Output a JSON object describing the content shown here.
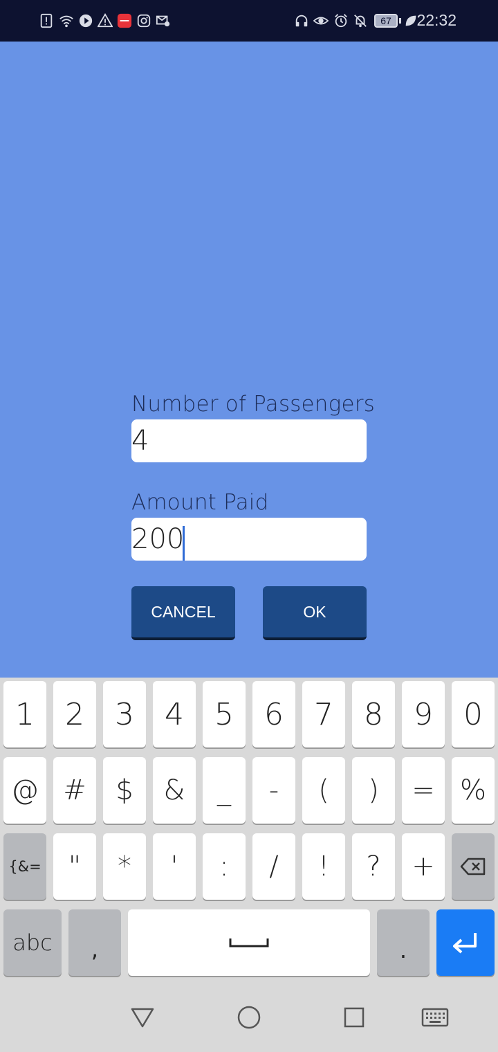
{
  "status_bar": {
    "battery_level": "67",
    "time": "22:32",
    "left_icons": [
      "alert-icon",
      "wifi-icon",
      "play-icon",
      "warning-icon",
      "huawei-app-icon",
      "instagram-icon",
      "mail-settings-icon"
    ],
    "right_icons": [
      "headset-icon",
      "eye-icon",
      "alarm-icon",
      "bell-off-icon",
      "battery-icon",
      "leaf-icon"
    ]
  },
  "form": {
    "passengers_label": "Number of Passengers",
    "passengers_value": "4",
    "amount_label": "Amount Paid",
    "amount_value": "200",
    "cancel_label": "CANCEL",
    "ok_label": "OK"
  },
  "keyboard": {
    "row1": [
      "1",
      "2",
      "3",
      "4",
      "5",
      "6",
      "7",
      "8",
      "9",
      "0"
    ],
    "row2": [
      "@",
      "#",
      "$",
      "&",
      "_",
      "-",
      "(",
      ")",
      "=",
      "%"
    ],
    "row3": [
      "{&=",
      "\"",
      "*",
      "'",
      ":",
      "/",
      "!",
      "?",
      "+"
    ],
    "abc_label": "abc",
    "comma_label": ",",
    "period_label": ".",
    "backspace_icon": "backspace-icon",
    "space_icon": "space-icon",
    "enter_icon": "enter-icon"
  },
  "colors": {
    "background": "#6893e6",
    "button": "#1d4a87",
    "enter_key": "#1a7cf5"
  },
  "nav_bar": {
    "icons": [
      "back-icon",
      "home-icon",
      "recents-icon",
      "keyboard-icon"
    ]
  }
}
